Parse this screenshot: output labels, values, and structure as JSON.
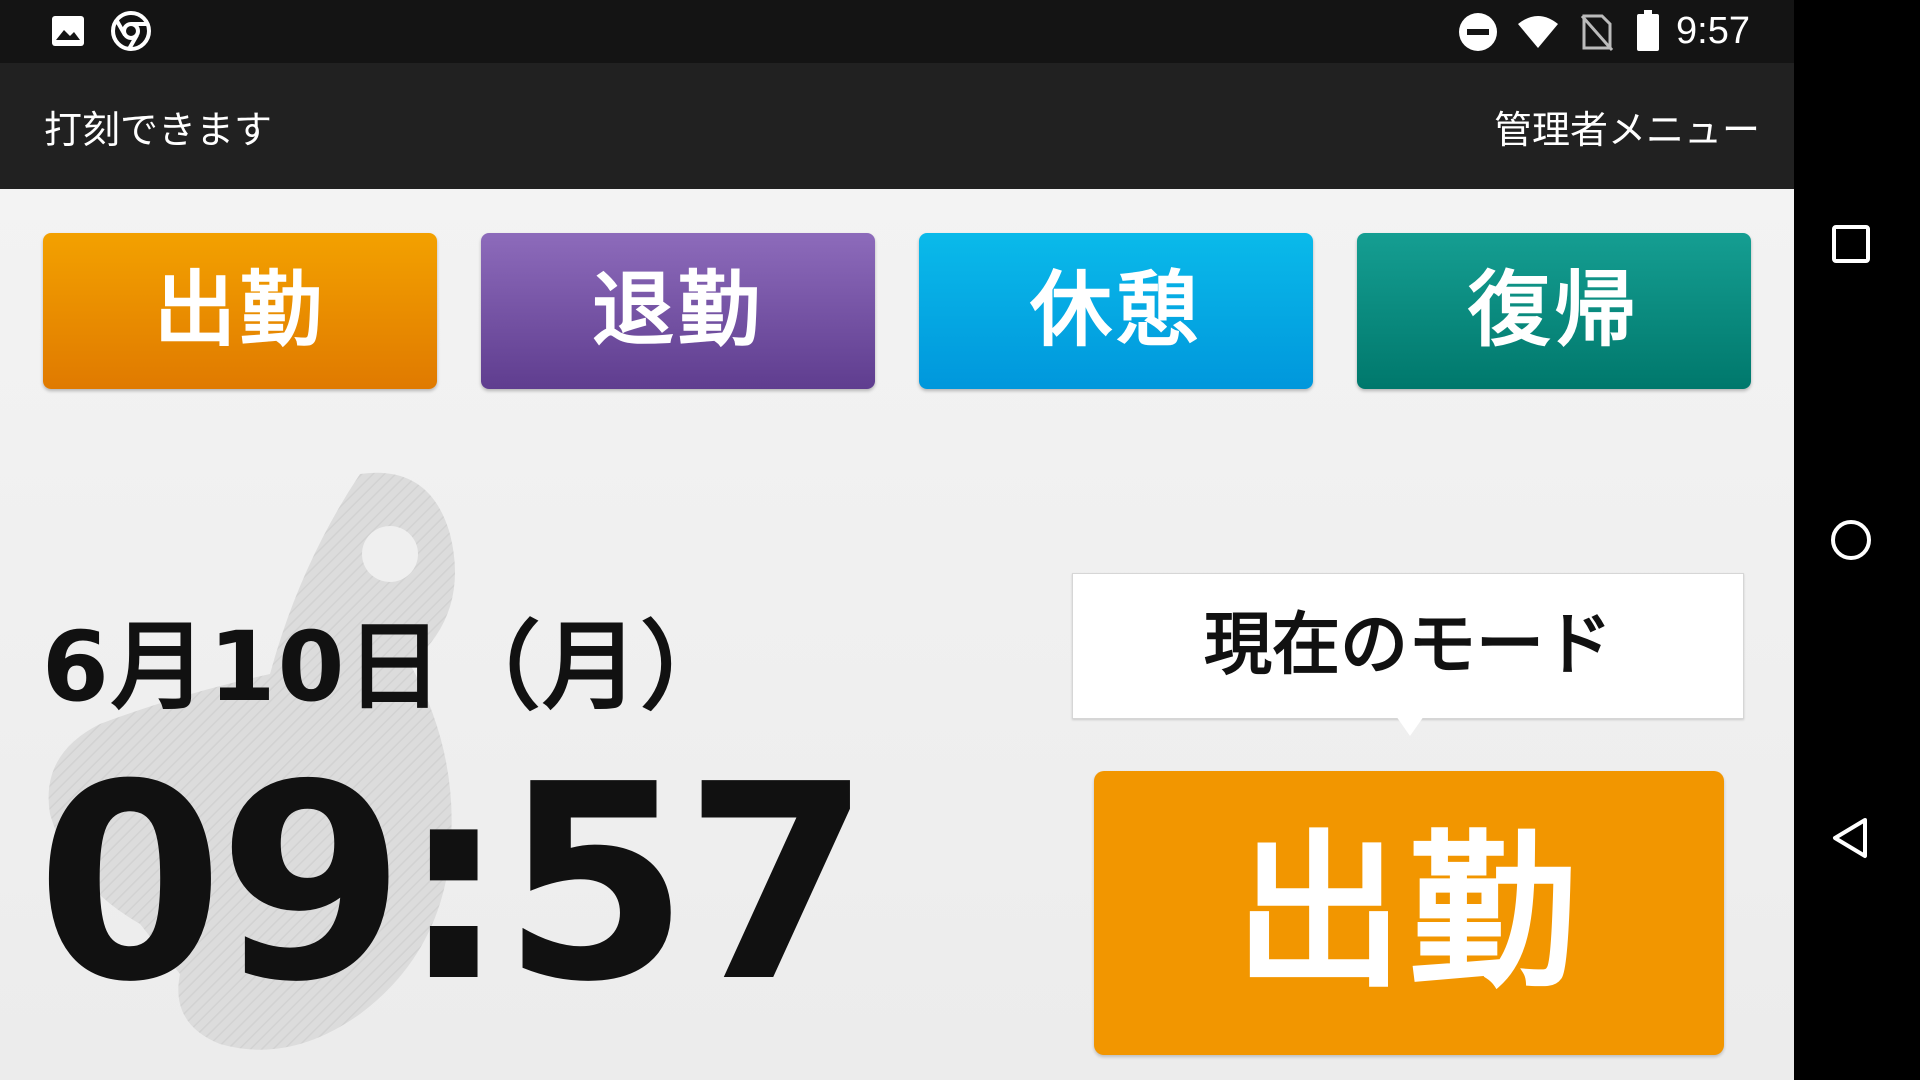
{
  "status_bar": {
    "time": "9:57",
    "left_icons": [
      "image-icon",
      "chrome-icon"
    ],
    "right_icons": [
      "do-not-disturb-icon",
      "wifi-icon",
      "no-sim-icon",
      "battery-icon"
    ]
  },
  "app_bar": {
    "title": "打刻できます",
    "admin_menu": "管理者メニュー"
  },
  "mode_buttons": [
    {
      "label": "出勤",
      "color": "#ef8c00"
    },
    {
      "label": "退勤",
      "color": "#7552a5"
    },
    {
      "label": "休憩",
      "color": "#05aae4"
    },
    {
      "label": "復帰",
      "color": "#0a8c80"
    }
  ],
  "clock": {
    "date": "6月10日（月）",
    "time": "09:57"
  },
  "current_mode": {
    "heading": "現在のモード",
    "value": "出勤",
    "color": "#f29600"
  },
  "nav_bar": {
    "buttons": [
      "recents-icon",
      "home-icon",
      "back-icon"
    ]
  }
}
